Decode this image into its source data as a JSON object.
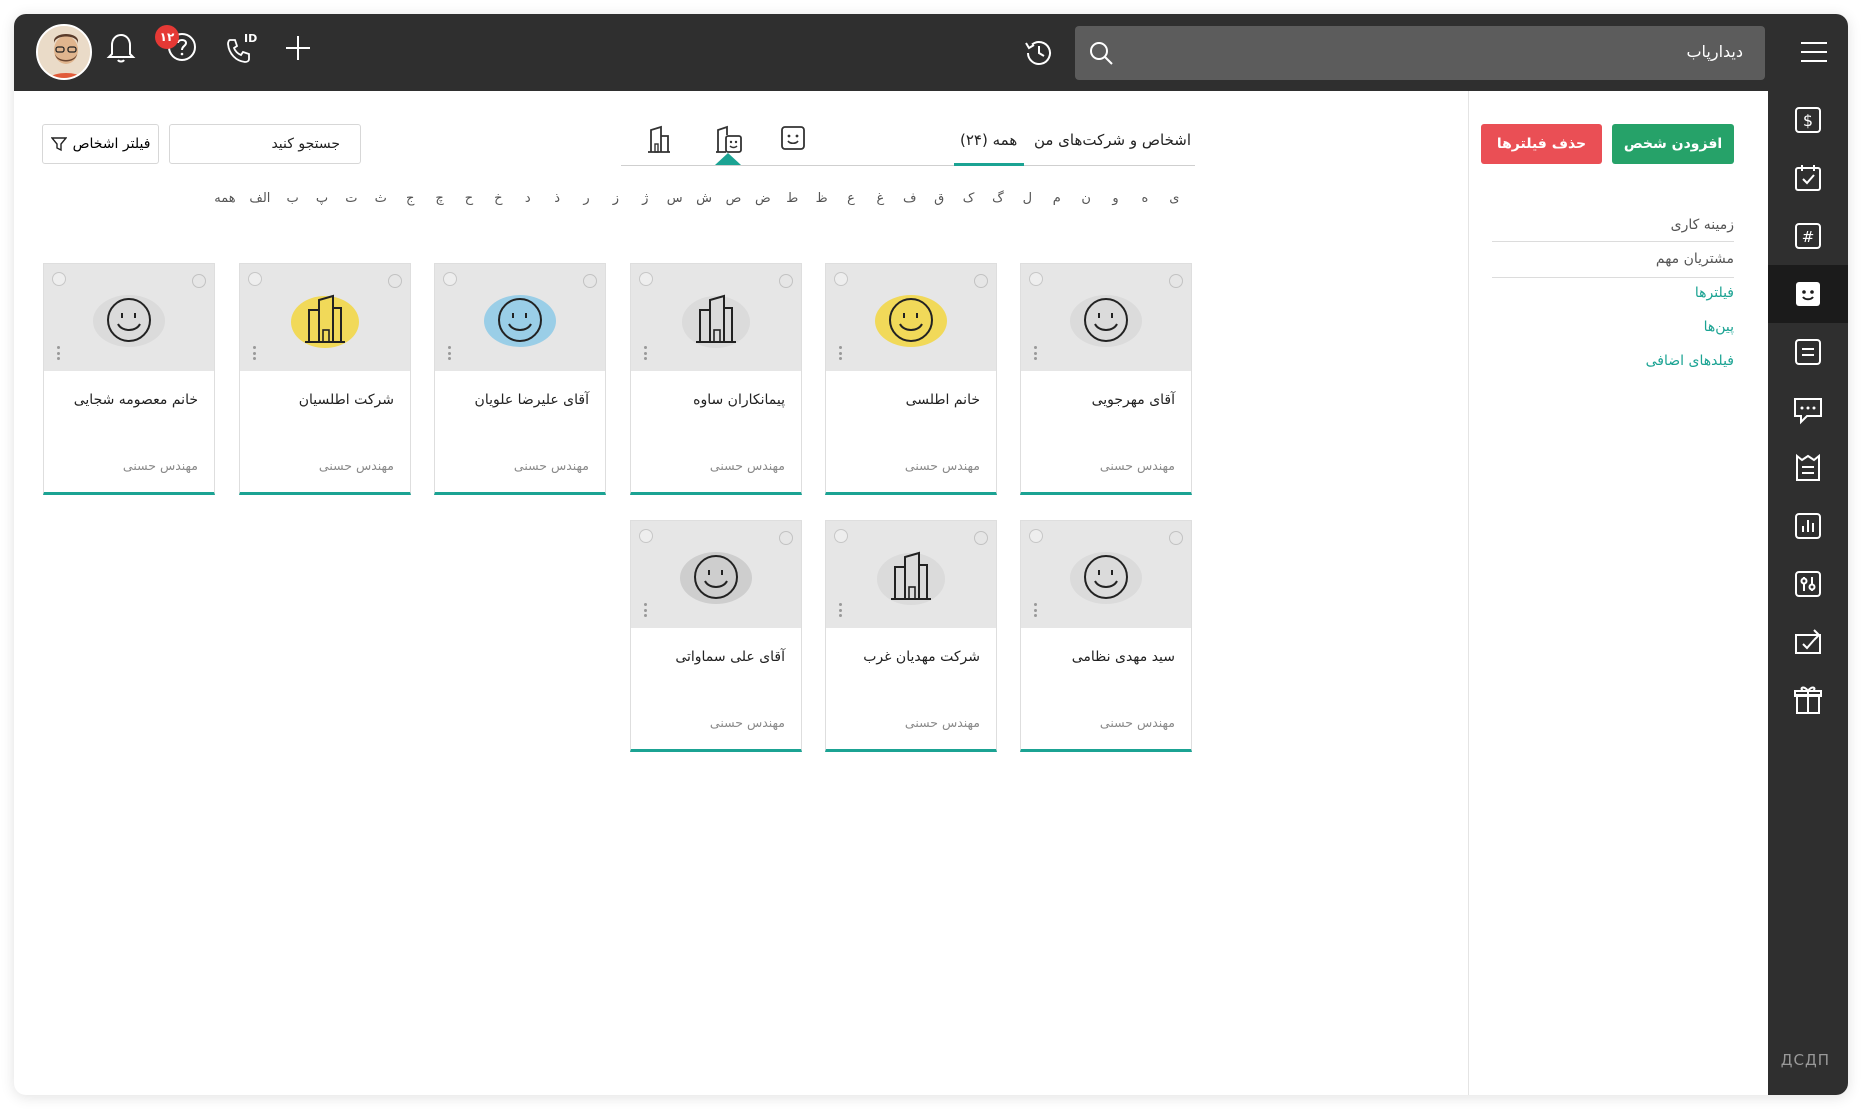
{
  "topbar": {
    "search_value": "دیدارپاب",
    "notification_count": "۱۲",
    "call_id_label": "ID"
  },
  "rail": {
    "items": [
      "dollar-icon",
      "calendar-check-icon",
      "hashtag-icon",
      "smiley-icon",
      "note-icon",
      "chat-icon",
      "ticket-icon",
      "chart-icon",
      "settings-sliders-icon",
      "task-transfer-icon",
      "gift-icon"
    ],
    "active": "smiley-icon",
    "logo": "ДСДП"
  },
  "side": {
    "add_person": "افزودن شخص",
    "clear_filters": "حذف فیلترها",
    "links": [
      {
        "label": "زمینه کاری",
        "style": "gray"
      },
      {
        "label": "مشتریان مهم",
        "style": "gray"
      },
      {
        "label": "فیلترها",
        "style": "teal"
      },
      {
        "label": "پین‌ها",
        "style": "teal"
      },
      {
        "label": "فیلدهای اضافی",
        "style": "teal"
      }
    ]
  },
  "toolbar": {
    "filter_people": "فیلتر اشخاص",
    "search_placeholder": "جستجو کنید",
    "tab_my": "اشخاص و شرکت‌های من",
    "tab_all": "همه (۲۴)"
  },
  "alphabet": [
    "همه",
    "الف",
    "ب",
    "پ",
    "ت",
    "ث",
    "ج",
    "چ",
    "ح",
    "خ",
    "د",
    "ذ",
    "ر",
    "ز",
    "ژ",
    "س",
    "ش",
    "ص",
    "ض",
    "ط",
    "ظ",
    "ع",
    "غ",
    "ف",
    "ق",
    "ک",
    "گ",
    "ل",
    "م",
    "ن",
    "و",
    "ه",
    "ی"
  ],
  "cards": [
    {
      "name": "آقای مهرجویی",
      "owner": "مهندس حسنی",
      "type": "person",
      "tint": "#d8d8d8"
    },
    {
      "name": "خانم اطلسی",
      "owner": "مهندس حسنی",
      "type": "person",
      "tint": "#f2d640"
    },
    {
      "name": "پیمانکاران ساوه",
      "owner": "مهندس حسنی",
      "type": "company",
      "tint": "#d8d8d8"
    },
    {
      "name": "آقای علیرضا علویان",
      "owner": "مهندس حسنی",
      "type": "person",
      "tint": "#8cc9e6"
    },
    {
      "name": "شرکت اطلسیان",
      "owner": "مهندس حسنی",
      "type": "company",
      "tint": "#f2d640"
    },
    {
      "name": "خانم معصومه شجایی",
      "owner": "مهندس حسنی",
      "type": "person",
      "tint": "#d8d8d8"
    },
    {
      "name": "سید مهدی نظامی",
      "owner": "مهندس حسنی",
      "type": "person",
      "tint": "#d8d8d8"
    },
    {
      "name": "شرکت مهدیان غرب",
      "owner": "مهندس حسنی",
      "type": "company",
      "tint": "#d8d8d8"
    },
    {
      "name": "آقای علی سماواتی",
      "owner": "مهندس حسنی",
      "type": "person",
      "tint": "#c9c9c9"
    }
  ]
}
